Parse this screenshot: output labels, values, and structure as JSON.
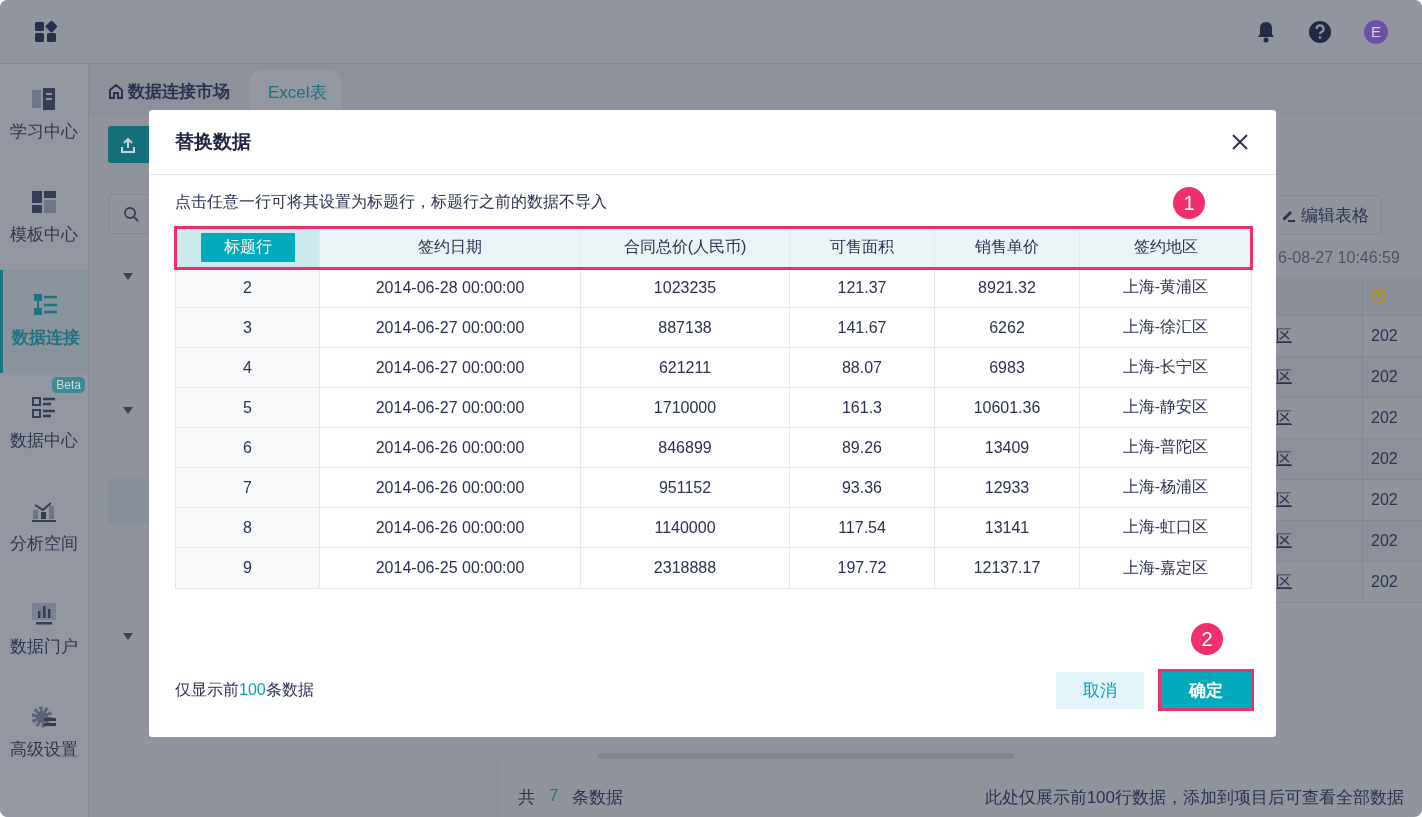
{
  "topbar": {
    "avatar": "E"
  },
  "sidebar": {
    "items": [
      {
        "label": "学习中心",
        "selected": false
      },
      {
        "label": "模板中心",
        "selected": false
      },
      {
        "label": "数据连接",
        "selected": true
      },
      {
        "label": "数据中心",
        "selected": false,
        "badge": "Beta"
      },
      {
        "label": "分析空间",
        "selected": false
      },
      {
        "label": "数据门户",
        "selected": false
      },
      {
        "label": "高级设置",
        "selected": false
      }
    ]
  },
  "breadcrumb": {
    "home": "数据连接市场",
    "tabs": [
      {
        "label": "Excel表",
        "selected": true
      }
    ]
  },
  "background": {
    "edit_button": "编辑表格",
    "timestamp": "6-08-27 10:46:59",
    "table": {
      "rows": [
        [
          "区",
          "202"
        ],
        [
          "区",
          "202"
        ],
        [
          "区",
          "202"
        ],
        [
          "区",
          "202"
        ],
        [
          "区",
          "202"
        ],
        [
          "区",
          "202"
        ],
        [
          "区",
          "202"
        ]
      ]
    },
    "footer": {
      "count_prefix": "共",
      "count": "7",
      "count_suffix": "条数据",
      "note": "此处仅展示前100行数据，添加到项目后可查看全部数据"
    }
  },
  "dialog": {
    "title": "替换数据",
    "hint": "点击任意一行可将其设置为标题行，标题行之前的数据不导入",
    "table": {
      "annotation": "1",
      "header": {
        "selected": true,
        "cells": [
          "标题行",
          "签约日期",
          "合同总价(人民币)",
          "可售面积",
          "销售单价",
          "签约地区"
        ]
      },
      "rows": [
        {
          "selected": false,
          "cells": [
            "2",
            "2014-06-28 00:00:00",
            "1023235",
            "121.37",
            "8921.32",
            "上海-黄浦区"
          ]
        },
        {
          "selected": false,
          "cells": [
            "3",
            "2014-06-27 00:00:00",
            "887138",
            "141.67",
            "6262",
            "上海-徐汇区"
          ]
        },
        {
          "selected": false,
          "cells": [
            "4",
            "2014-06-27 00:00:00",
            "621211",
            "88.07",
            "6983",
            "上海-长宁区"
          ]
        },
        {
          "selected": false,
          "cells": [
            "5",
            "2014-06-27 00:00:00",
            "1710000",
            "161.3",
            "10601.36",
            "上海-静安区"
          ]
        },
        {
          "selected": false,
          "cells": [
            "6",
            "2014-06-26 00:00:00",
            "846899",
            "89.26",
            "13409",
            "上海-普陀区"
          ]
        },
        {
          "selected": false,
          "cells": [
            "7",
            "2014-06-26 00:00:00",
            "951152",
            "93.36",
            "12933",
            "上海-杨浦区"
          ]
        },
        {
          "selected": false,
          "cells": [
            "8",
            "2014-06-26 00:00:00",
            "1140000",
            "117.54",
            "13141",
            "上海-虹口区"
          ]
        },
        {
          "selected": false,
          "cells": [
            "9",
            "2014-06-25 00:00:00",
            "2318888",
            "197.72",
            "12137.17",
            "上海-嘉定区"
          ]
        }
      ]
    },
    "footer_prefix": "仅显示前",
    "footer_count": "100",
    "footer_suffix": "条数据",
    "cancel": "取消",
    "confirm": "确定",
    "confirm_annotation": "2"
  }
}
